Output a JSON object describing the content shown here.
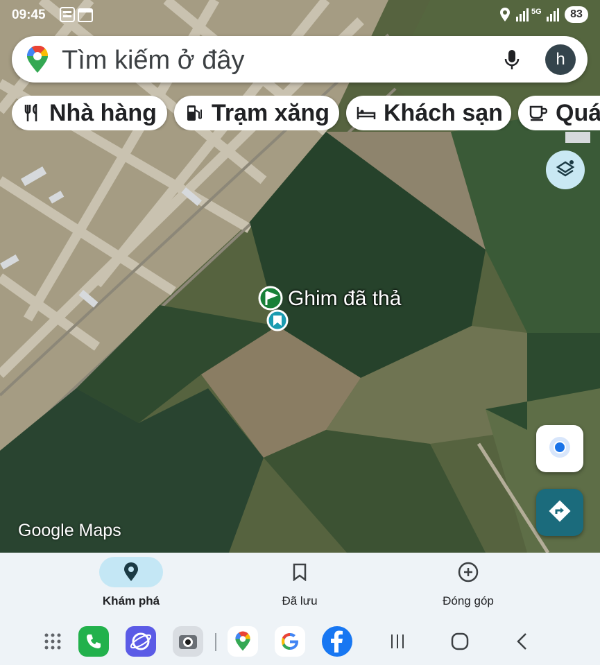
{
  "status_bar": {
    "time": "09:45",
    "battery": "83",
    "network": "5G",
    "icons": [
      "bao-moi-icon",
      "calendar-icon",
      "location-icon",
      "signal-icon",
      "signal-5g-icon",
      "battery-icon"
    ]
  },
  "search": {
    "placeholder": "Tìm kiếm ở đây",
    "avatar_letter": "h"
  },
  "chips": [
    {
      "label": "Nhà hàng",
      "icon": "restaurant-icon"
    },
    {
      "label": "Trạm xăng",
      "icon": "gas-station-icon"
    },
    {
      "label": "Khách sạn",
      "icon": "hotel-icon"
    },
    {
      "label": "Quá",
      "icon": "coffee-icon"
    }
  ],
  "map": {
    "pin_label": "Ghim đã thả",
    "attribution": "Google Maps",
    "layer": "satellite"
  },
  "bottom_nav": [
    {
      "label": "Khám phá",
      "icon": "explore-pin-icon",
      "active": true
    },
    {
      "label": "Đã lưu",
      "icon": "bookmark-icon",
      "active": false
    },
    {
      "label": "Đóng góp",
      "icon": "add-circle-icon",
      "active": false
    }
  ],
  "dock": {
    "apps": [
      "app-drawer-icon",
      "phone-icon",
      "browser-icon",
      "camera-icon",
      "google-maps-icon",
      "google-icon",
      "facebook-icon"
    ],
    "system": [
      "recents-icon",
      "home-icon",
      "back-icon"
    ]
  },
  "colors": {
    "accent": "#1b6b7c",
    "nav_active": "#c4e7f5",
    "pin_green": "#188038",
    "pin_teal": "#1a9bb0"
  }
}
